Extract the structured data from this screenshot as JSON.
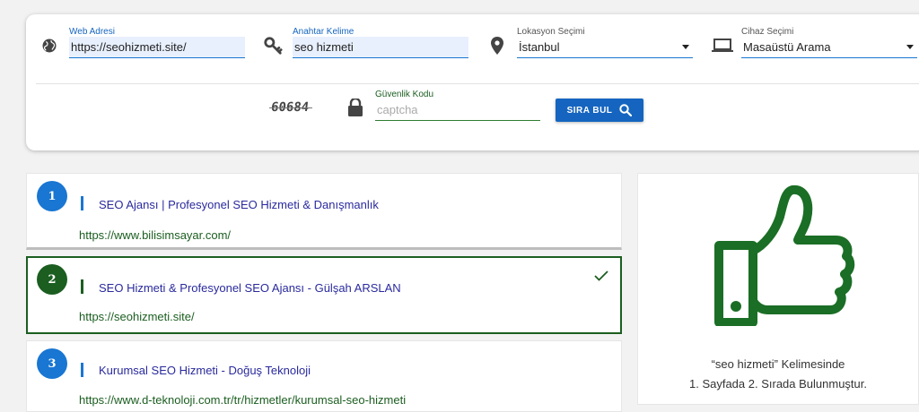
{
  "form": {
    "website": {
      "label": "Web Adresi",
      "value": "https://seohizmeti.site/"
    },
    "keyword": {
      "label": "Anahtar Kelime",
      "value": "seo hizmeti"
    },
    "location": {
      "label": "Lokasyon Seçimi",
      "value": "İstanbul"
    },
    "device": {
      "label": "Cihaz Seçimi",
      "value": "Masaüstü Arama"
    },
    "security": {
      "label": "Güvenlik Kodu",
      "placeholder": "captcha",
      "captcha_text": "60684"
    },
    "search_button": {
      "label": "SIRA BUL"
    }
  },
  "results": [
    {
      "rank": "1",
      "title": "SEO Ajansı | Profesyonel SEO Hizmeti & Danışmanlık",
      "url": "https://www.bilisimsayar.com/"
    },
    {
      "rank": "2",
      "title": "SEO Hizmeti & Profesyonel SEO Ajansı - Gülşah ARSLAN",
      "url": "https://seohizmeti.site/"
    },
    {
      "rank": "3",
      "title": "Kurumsal SEO Hizmeti - Doğuş Teknoloji",
      "url": "https://www.d-teknoloji.com.tr/tr/hizmetler/kurumsal-seo-hizmeti"
    }
  ],
  "summary": {
    "line1": "“seo hizmeti” Kelimesinde",
    "line2": "1. Sayfada 2. Sırada Bulunmuştur."
  },
  "colors": {
    "primary": "#1565c0",
    "success": "#1b5e20",
    "rank_blue": "#1976d2"
  },
  "icons": [
    "globe-icon",
    "key-icon",
    "location-pin-icon",
    "laptop-icon",
    "lock-icon",
    "search-icon",
    "check-icon",
    "thumbs-up-icon"
  ]
}
